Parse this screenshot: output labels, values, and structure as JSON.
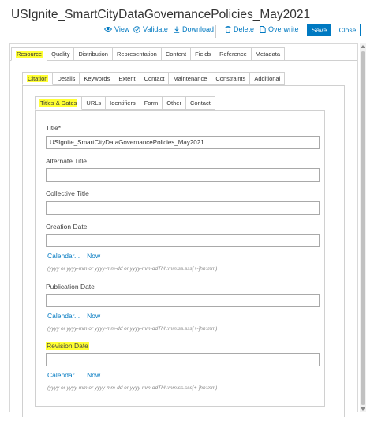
{
  "title": "USIgnite_SmartCityDataGovernancePolicies_May2021",
  "toolbar": {
    "view": "View",
    "validate": "Validate",
    "download": "Download",
    "delete": "Delete",
    "overwrite": "Overwrite",
    "save": "Save",
    "close": "Close"
  },
  "top_tabs": [
    "Resource",
    "Quality",
    "Distribution",
    "Representation",
    "Content",
    "Fields",
    "Reference",
    "Metadata"
  ],
  "resource_tabs": [
    "Citation",
    "Details",
    "Keywords",
    "Extent",
    "Contact",
    "Maintenance",
    "Constraints",
    "Additional"
  ],
  "citation_tabs": [
    "Titles & Dates",
    "URLs",
    "Identifiers",
    "Form",
    "Other",
    "Contact"
  ],
  "highlight_color": "#ffff33",
  "accent_color": "#0079c1",
  "form": {
    "title_label": "Title*",
    "title_value": "USIgnite_SmartCityDataGovernancePolicies_May2021",
    "alternate_title_label": "Alternate Title",
    "collective_title_label": "Collective Title",
    "creation_date_label": "Creation Date",
    "publication_date_label": "Publication Date",
    "revision_date_label": "Revision Date",
    "calendar_link": "Calendar...",
    "now_link": "Now",
    "date_hint": "(yyyy or yyyy-mm or yyyy-mm-dd or yyyy-mm-ddThh:mm:ss.sss[+-]hh:mm)"
  }
}
